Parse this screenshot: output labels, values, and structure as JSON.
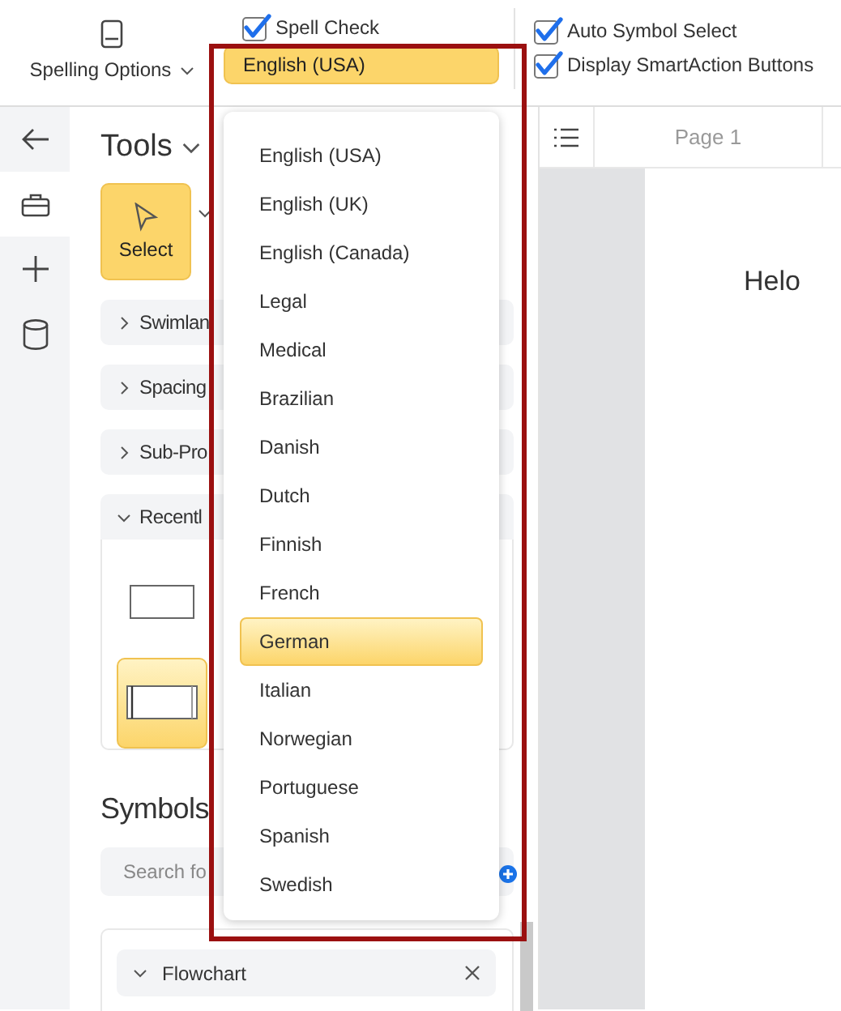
{
  "toolbar": {
    "spelling_options": {
      "label": "Spelling Options"
    },
    "spell_check": {
      "label": "Spell Check",
      "checked": true
    },
    "language_select": {
      "value": "English (USA)"
    },
    "options": [
      {
        "label": "Auto Symbol Select",
        "checked": true
      },
      {
        "label": "Display SmartAction Buttons",
        "checked": true
      }
    ]
  },
  "tools_panel": {
    "title": "Tools",
    "select_tool": {
      "label": "Select",
      "selected": true
    },
    "sections": [
      {
        "label": "Swimlan",
        "expanded": false
      },
      {
        "label": "Spacing",
        "expanded": false
      },
      {
        "label": "Sub-Pro",
        "expanded": false
      },
      {
        "label": "Recentl",
        "expanded": true
      }
    ],
    "recent_shapes": [
      {
        "kind": "rectangle",
        "selected": false
      },
      {
        "kind": "process",
        "selected": true
      }
    ]
  },
  "symbols_panel": {
    "title": "Symbols",
    "search": {
      "placeholder": "Search fo"
    },
    "libraries": [
      {
        "label": "Flowchart",
        "expanded": true
      }
    ]
  },
  "language_dropdown": {
    "options": [
      {
        "label": "English (USA)",
        "selected": false
      },
      {
        "label": "English (UK)",
        "selected": false
      },
      {
        "label": "English (Canada)",
        "selected": false
      },
      {
        "label": "Legal",
        "selected": false
      },
      {
        "label": "Medical",
        "selected": false
      },
      {
        "label": "Brazilian",
        "selected": false
      },
      {
        "label": "Danish",
        "selected": false
      },
      {
        "label": "Dutch",
        "selected": false
      },
      {
        "label": "Finnish",
        "selected": false
      },
      {
        "label": "French",
        "selected": false
      },
      {
        "label": "German",
        "selected": true
      },
      {
        "label": "Italian",
        "selected": false
      },
      {
        "label": "Norwegian",
        "selected": false
      },
      {
        "label": "Portuguese",
        "selected": false
      },
      {
        "label": "Spanish",
        "selected": false
      },
      {
        "label": "Swedish",
        "selected": false
      }
    ]
  },
  "canvas": {
    "page_tab": "Page 1",
    "text": "Helo"
  }
}
